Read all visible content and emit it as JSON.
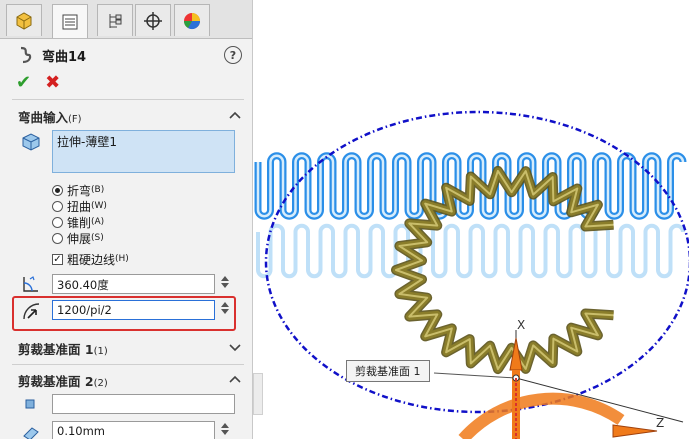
{
  "tabs": [
    {
      "name": "feature-manager",
      "icon": "feature-tree-icon"
    },
    {
      "name": "property-manager",
      "icon": "property-list-icon"
    },
    {
      "name": "configuration-manager",
      "icon": "configuration-icon"
    },
    {
      "name": "dimxpert-manager",
      "icon": "crosshair-icon"
    },
    {
      "name": "display-manager",
      "icon": "appearance-pie-icon"
    }
  ],
  "feature": {
    "title": "弯曲14",
    "help": "?"
  },
  "actions": {
    "ok": "✔",
    "cancel": "✖"
  },
  "flex_input": {
    "heading": "弯曲输入",
    "heading_key": "(F)",
    "selected_body": "拉伸-薄壁1",
    "options": [
      {
        "label": "折弯",
        "key": "(B)",
        "selected": true
      },
      {
        "label": "扭曲",
        "key": "(W)",
        "selected": false
      },
      {
        "label": "锥削",
        "key": "(A)",
        "selected": false
      },
      {
        "label": "伸展",
        "key": "(S)",
        "selected": false
      }
    ],
    "hard_edges": {
      "label": "粗硬边线",
      "key": "(H)",
      "checked": true
    },
    "angle": "360.40度",
    "radius": "1200/pi/2"
  },
  "trim_plane_1": {
    "heading": "剪裁基准面",
    "num": "1",
    "key": "(1)"
  },
  "trim_plane_2": {
    "heading": "剪裁基准面",
    "num": "2",
    "key": "(2)",
    "selection": "",
    "offset": "0.10mm"
  },
  "viewport": {
    "callout": "剪裁基准面 1",
    "axis_x": "X",
    "axis_z": "Z",
    "colors": {
      "ring_blue": "#2b8fe8",
      "ring_olive": "#8a7d2a",
      "ellipse": "#1010c8",
      "triad_orange": "#f07a1a",
      "highlight": "#d9302e"
    }
  }
}
